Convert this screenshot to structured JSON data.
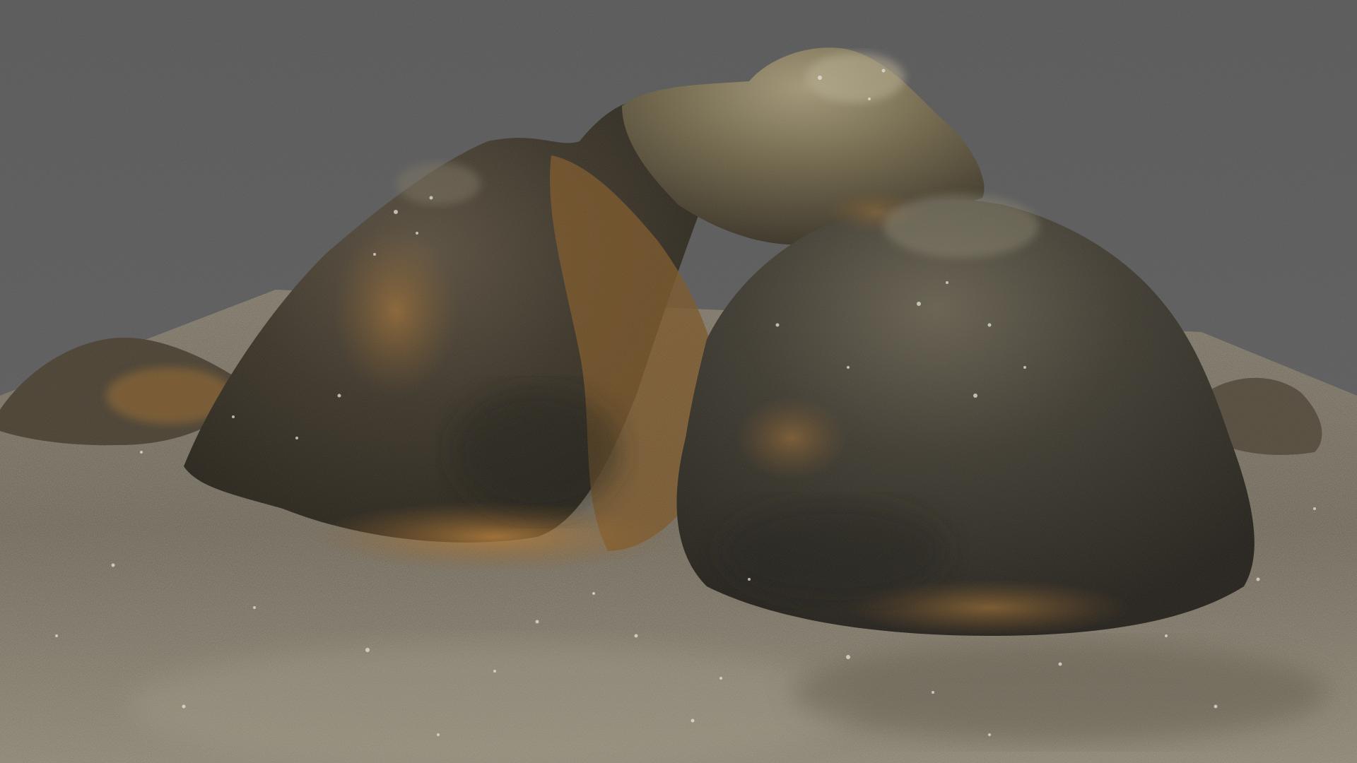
{
  "scene": {
    "subject": "rock-formation",
    "colors": {
      "background": "#5b5b5c",
      "rock_dark": "#2e2a22",
      "rock_mid": "#4a4233",
      "rock_light": "#8c8266",
      "ochre": "#9a6a2e",
      "ground": "#6f6657",
      "ground_light": "#9a927f",
      "speckle": "#e6e3da"
    }
  }
}
